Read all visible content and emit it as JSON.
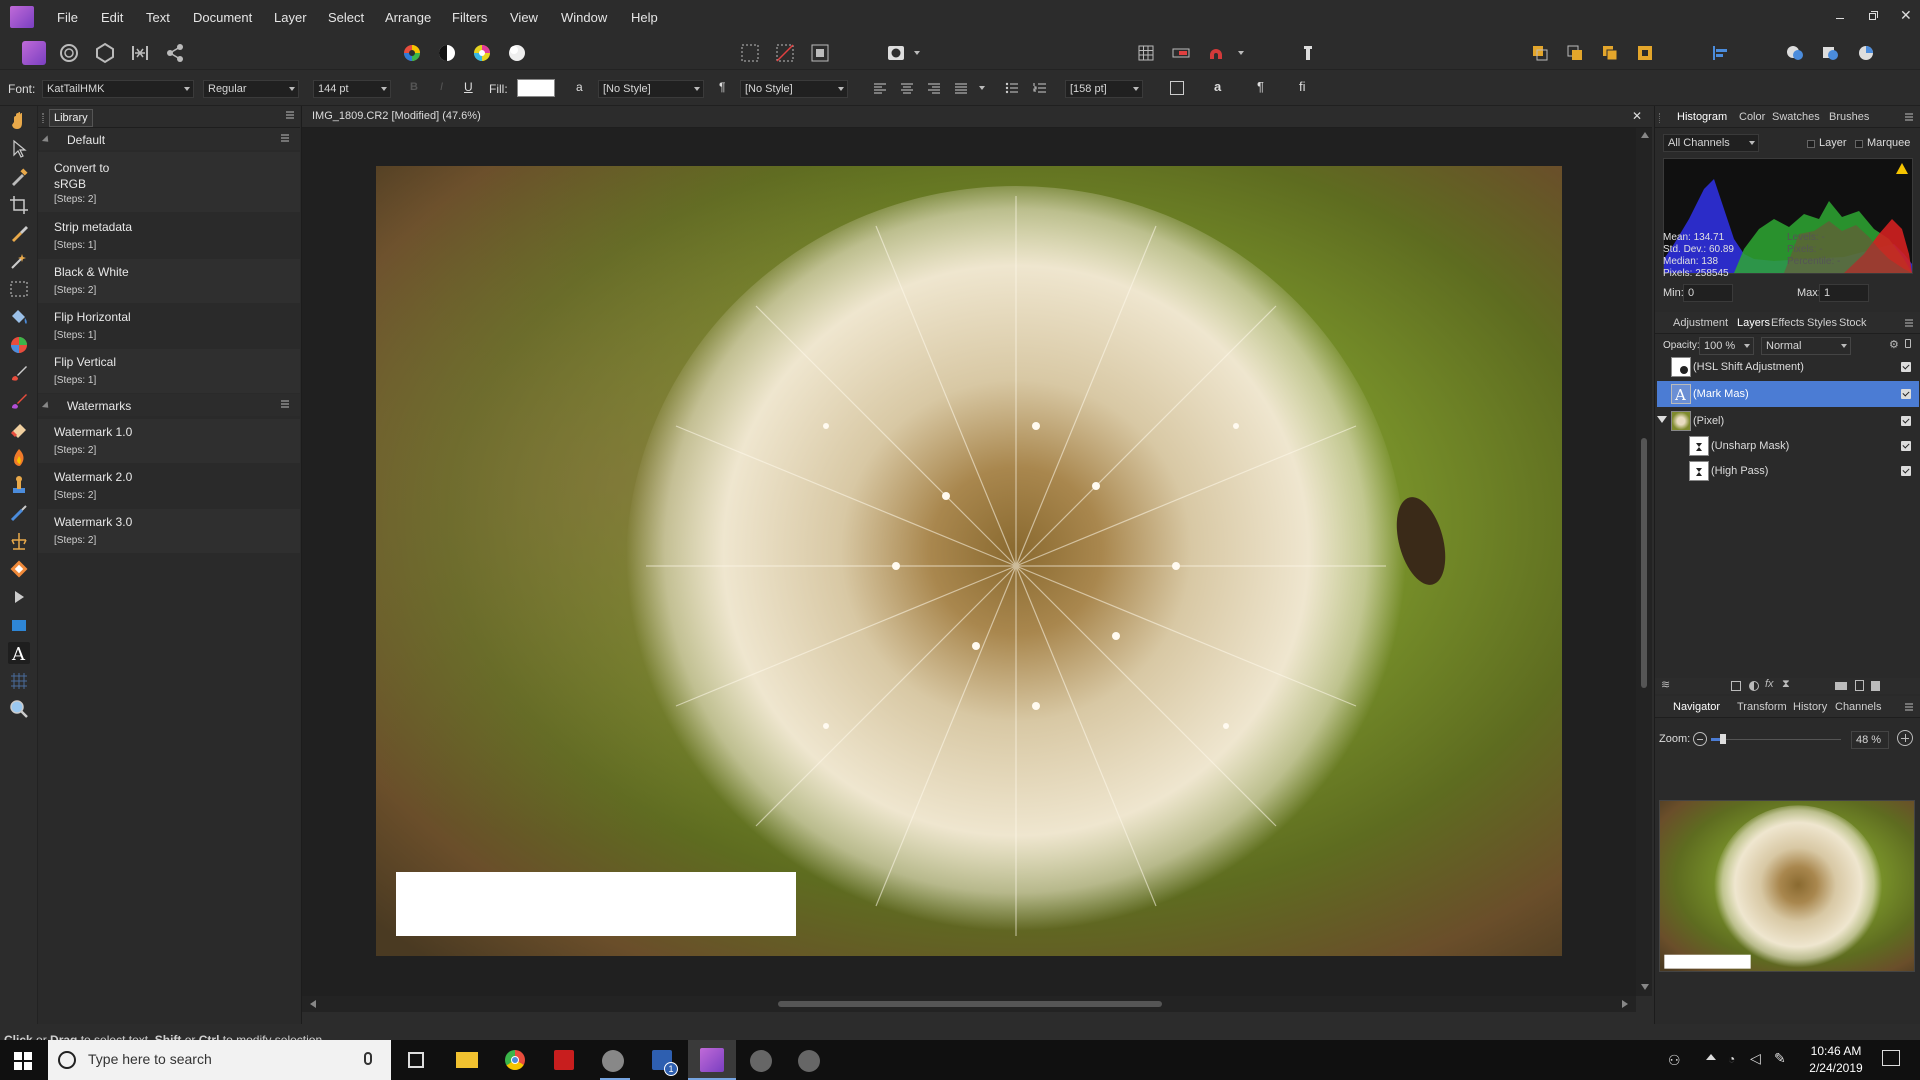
{
  "app": {
    "name": "Affinity Photo",
    "accent": "#4b7cd4",
    "window_controls": [
      "minimize",
      "restore",
      "close"
    ]
  },
  "menu": [
    "File",
    "Edit",
    "Text",
    "Document",
    "Layer",
    "Select",
    "Arrange",
    "Filters",
    "View",
    "Window",
    "Help"
  ],
  "context": {
    "font_label": "Font:",
    "font_name": "KatTailHMK",
    "font_style": "Regular",
    "font_size": "144 pt",
    "fill_label": "Fill:",
    "char_style": "[No Style]",
    "para_style": "[No Style]",
    "leading": "[158 pt]",
    "bold": "B",
    "italic": "I",
    "underline": "U"
  },
  "library": {
    "tab": "Library",
    "groups": [
      {
        "name": "Default",
        "items": [
          {
            "title": "Convert to\nsRGB",
            "steps": "[Steps: 2]"
          },
          {
            "title": "Strip metadata",
            "steps": "[Steps: 1]"
          },
          {
            "title": "Black & White",
            "steps": "[Steps: 2]"
          },
          {
            "title": "Flip Horizontal",
            "steps": "[Steps: 1]"
          },
          {
            "title": "Flip Vertical",
            "steps": "[Steps: 1]"
          }
        ]
      },
      {
        "name": "Watermarks",
        "items": [
          {
            "title": "Watermark 1.0",
            "steps": "[Steps: 2]"
          },
          {
            "title": "Watermark 2.0",
            "steps": "[Steps: 2]"
          },
          {
            "title": "Watermark 3.0",
            "steps": "[Steps: 2]"
          }
        ]
      }
    ]
  },
  "document": {
    "title": "IMG_1809.CR2 [Modified] (47.6%)"
  },
  "histogram_panel": {
    "tabs": [
      "Histogram",
      "Color",
      "Swatches",
      "Brushes"
    ],
    "channel": "All Channels",
    "layer_label": "Layer",
    "marquee_label": "Marquee",
    "mean": "Mean: 134.71",
    "std_dev": "Std. Dev.: 60.89",
    "median": "Median: 138",
    "pixels": "Pixels: 258545",
    "levels": "Levels: -",
    "pixels_r": "Pixels: -",
    "percentile": "Percentile: -",
    "min_label": "Min:",
    "min_value": "0",
    "max_label": "Max:",
    "max_value": "1"
  },
  "layers_panel": {
    "tabs": [
      "Adjustment",
      "Layers",
      "Effects",
      "Styles",
      "Stock"
    ],
    "opacity_label": "Opacity:",
    "opacity_value": "100 %",
    "blend_mode": "Normal",
    "layers": [
      {
        "name": "(HSL Shift Adjustment)",
        "selected": false,
        "indent": 0
      },
      {
        "name": "(Mark Mas)",
        "selected": true,
        "indent": 0
      },
      {
        "name": "(Pixel)",
        "selected": false,
        "indent": 0
      },
      {
        "name": "(Unsharp Mask)",
        "selected": false,
        "indent": 1
      },
      {
        "name": "(High Pass)",
        "selected": false,
        "indent": 1
      }
    ]
  },
  "navigator_panel": {
    "tabs": [
      "Navigator",
      "Transform",
      "History",
      "Channels"
    ],
    "zoom_label": "Zoom:",
    "zoom_value": "48 %",
    "zoom_level": 0.48
  },
  "status": {
    "bold1": "Click",
    "t1": " or ",
    "bold2": "Drag",
    "t2": " to select text. ",
    "bold3": "Shift",
    "t3": " or ",
    "bold4": "Ctrl",
    "t4": " to modify selection."
  },
  "taskbar": {
    "search_placeholder": "Type here to search",
    "time": "10:46 AM",
    "date": "2/24/2019",
    "badge": "1"
  }
}
